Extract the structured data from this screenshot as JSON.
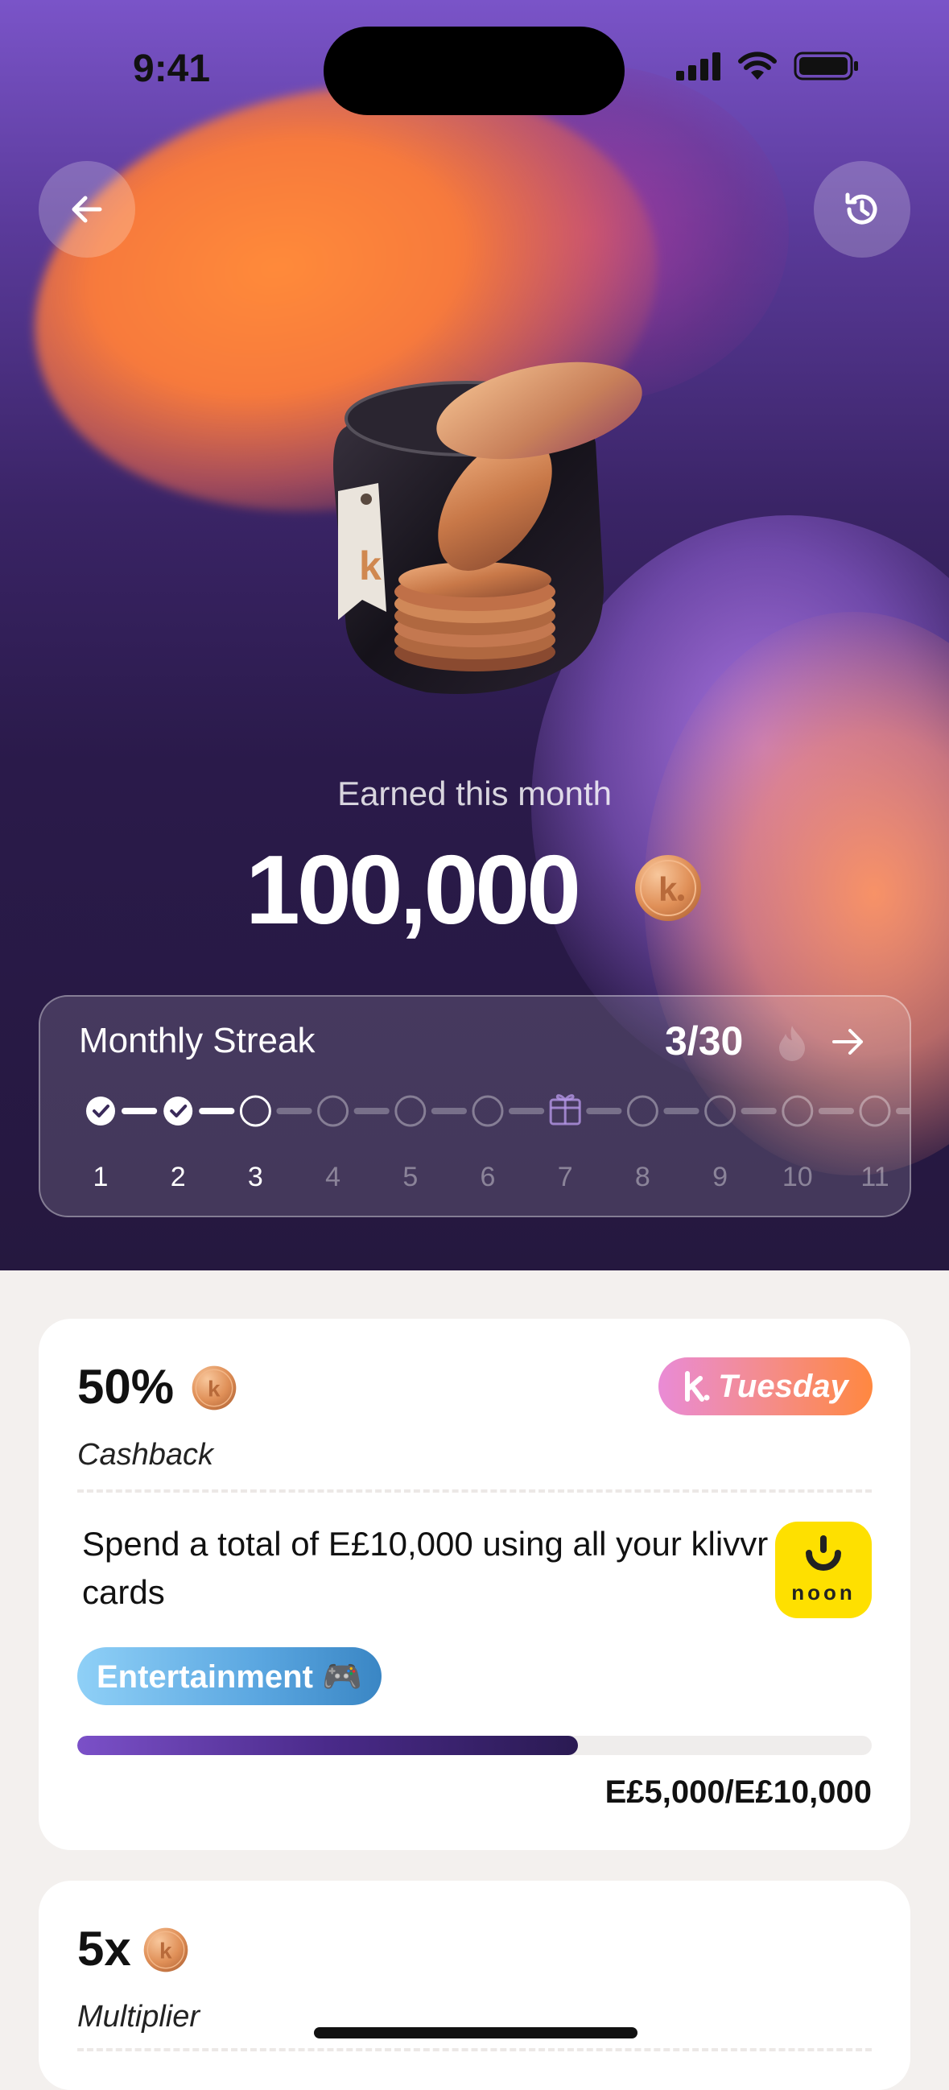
{
  "status_bar": {
    "time": "9:41"
  },
  "header": {
    "back_icon": "arrow-left-icon",
    "history_icon": "history-clock-icon"
  },
  "earnings": {
    "label": "Earned this month",
    "amount": "100,000",
    "coin_icon": "k-coin-icon"
  },
  "streak": {
    "title": "Monthly Streak",
    "count": "3/30",
    "days": [
      {
        "label": "1",
        "state": "done"
      },
      {
        "label": "2",
        "state": "done"
      },
      {
        "label": "3",
        "state": "current"
      },
      {
        "label": "4",
        "state": "upcoming"
      },
      {
        "label": "5",
        "state": "upcoming"
      },
      {
        "label": "6",
        "state": "upcoming"
      },
      {
        "label": "7",
        "state": "gift"
      },
      {
        "label": "8",
        "state": "upcoming"
      },
      {
        "label": "9",
        "state": "upcoming"
      },
      {
        "label": "10",
        "state": "upcoming"
      },
      {
        "label": "11",
        "state": "upcoming"
      }
    ]
  },
  "cards": [
    {
      "value": "50%",
      "type_label": "Cashback",
      "badge_text": "Tuesday",
      "description": "Spend a total of E£10,000 using all your klivvr cards",
      "merchant": "noon",
      "category": "Entertainment 🎮",
      "progress_fraction": 0.63,
      "progress_text": "E£5,000/E£10,000"
    },
    {
      "value": "5x",
      "type_label": "Multiplier"
    }
  ],
  "colors": {
    "accent_purple": "#7b50c8",
    "tuesday_gradient": [
      "#e98bd6",
      "#ff8840"
    ],
    "noon_yellow": "#fee000"
  }
}
